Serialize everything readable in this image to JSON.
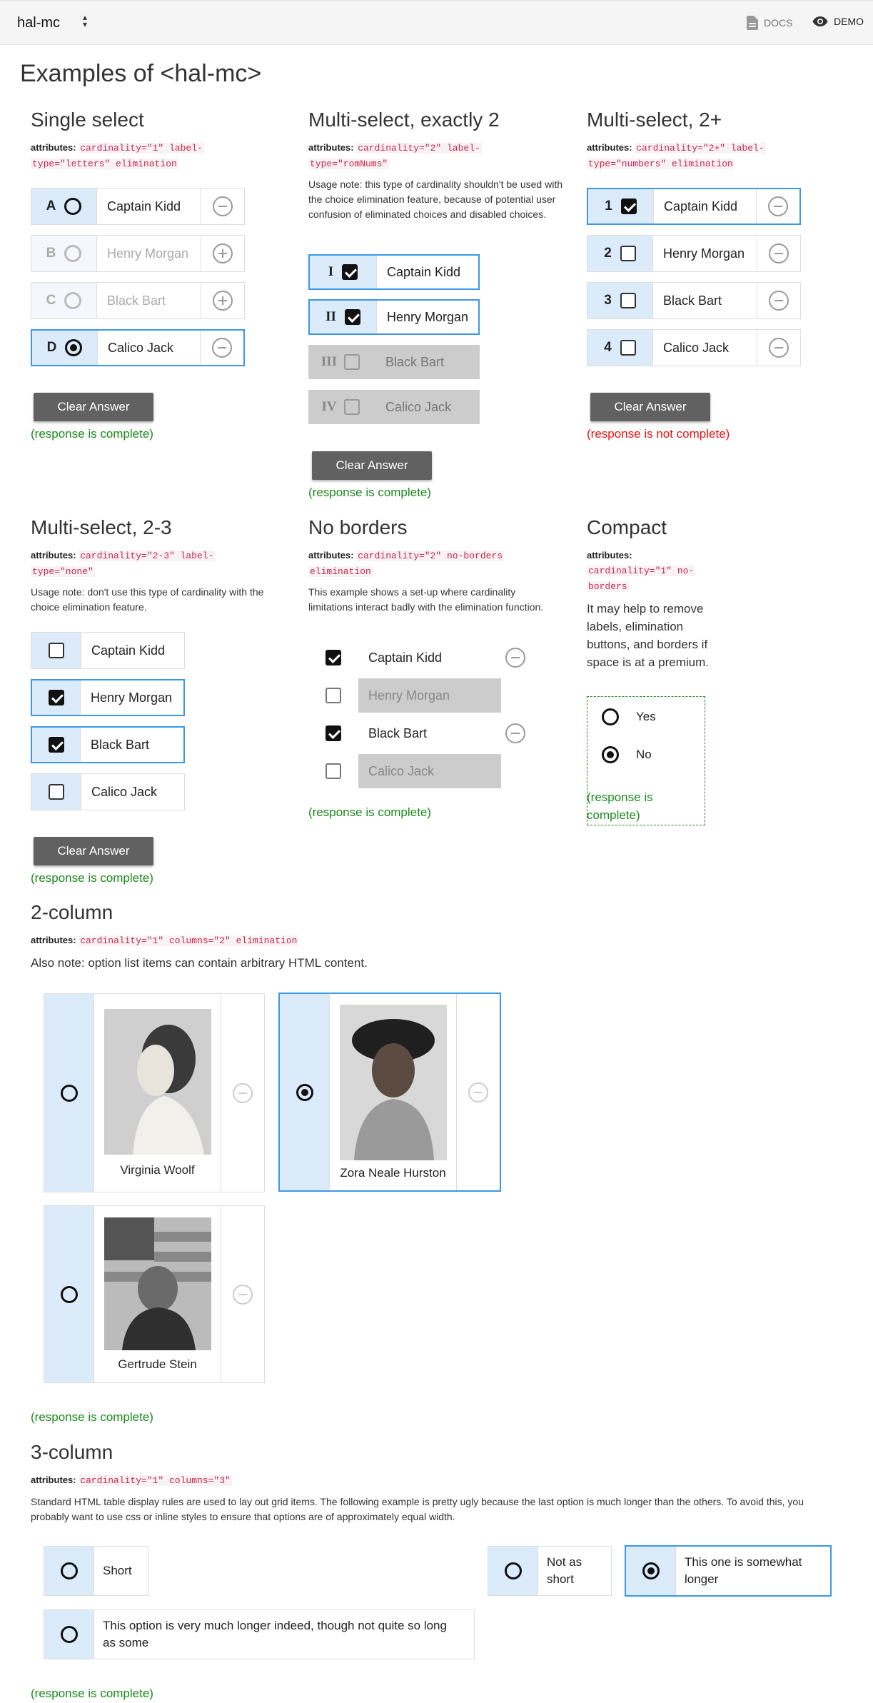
{
  "topbar": {
    "app_select": "hal-mc",
    "select_arrows": "▴\n▾",
    "docs_label": "DOCS",
    "demo_label": "DEMO"
  },
  "page_title": "Examples of <hal-mc>",
  "single": {
    "title": "Single select",
    "attrs_label": "attributes:",
    "attrs_line1": "cardinality=\"1\" label-",
    "attrs_line2": "type=\"letters\" elimination",
    "options": [
      {
        "letter": "A",
        "text": "Captain Kidd"
      },
      {
        "letter": "B",
        "text": "Henry Morgan"
      },
      {
        "letter": "C",
        "text": "Black Bart"
      },
      {
        "letter": "D",
        "text": "Calico Jack"
      }
    ],
    "clear_label": "Clear Answer",
    "status": "(response is complete)"
  },
  "multi2": {
    "title": "Multi-select, exactly 2",
    "attrs_label": "attributes:",
    "attrs_line1": "cardinality=\"2\" label-",
    "attrs_line2": "type=\"romNums\"",
    "note": "Usage note: this type of cardinality shouldn't be used with the choice elimination feature, because of potential user confusion of eliminated choices and disabled choices.",
    "options": [
      {
        "letter": "I",
        "text": "Captain Kidd"
      },
      {
        "letter": "II",
        "text": "Henry Morgan"
      },
      {
        "letter": "III",
        "text": "Black Bart"
      },
      {
        "letter": "IV",
        "text": "Calico Jack"
      }
    ],
    "clear_label": "Clear Answer",
    "status": "(response is complete)"
  },
  "multi2plus": {
    "title": "Multi-select, 2+",
    "attrs_label": "attributes:",
    "attrs_line1": "cardinality=\"2+\" label-",
    "attrs_line2": "type=\"numbers\" elimination",
    "options": [
      {
        "letter": "1",
        "text": "Captain Kidd"
      },
      {
        "letter": "2",
        "text": "Henry Morgan"
      },
      {
        "letter": "3",
        "text": "Black Bart"
      },
      {
        "letter": "4",
        "text": "Calico Jack"
      }
    ],
    "clear_label": "Clear Answer",
    "status": "(response is not complete)"
  },
  "multi23": {
    "title": "Multi-select, 2-3",
    "attrs_label": "attributes:",
    "attrs_line1": "cardinality=\"2-3\" label-",
    "attrs_line2": "type=\"none\"",
    "note": "Usage note: don't use this type of cardinality with the choice elimination feature.",
    "options": [
      "Captain Kidd",
      "Henry Morgan",
      "Black Bart",
      "Calico Jack"
    ],
    "clear_label": "Clear Answer",
    "status": "(response is complete)"
  },
  "noborders": {
    "title": "No borders",
    "attrs_label": "attributes:",
    "attrs_line1": "cardinality=\"2\" no-borders",
    "attrs_line2": "elimination",
    "note": "This example shows a set-up where cardinality limitations interact badly with the elimination function.",
    "options": [
      "Captain Kidd",
      "Henry Morgan",
      "Black Bart",
      "Calico Jack"
    ],
    "status": "(response is complete)"
  },
  "compact": {
    "title": "Compact",
    "attrs_label": "attributes:",
    "attrs_line1": "cardinality=\"1\" no-",
    "attrs_line2": "borders",
    "note": "It may help to remove labels, elimination buttons, and borders if space is at a premium.",
    "options": [
      "Yes",
      "No"
    ],
    "status": "(response is complete)"
  },
  "twocol": {
    "title": "2-column",
    "attrs_label": "attributes:",
    "attrs": "cardinality=\"1\" columns=\"2\" elimination",
    "note": "Also note: option list items can contain arbitrary HTML content.",
    "options": [
      "Virginia Woolf",
      "Zora Neale Hurston",
      "Gertrude Stein"
    ],
    "status": "(response is complete)"
  },
  "threecol": {
    "title": "3-column",
    "attrs_label": "attributes:",
    "attrs": "cardinality=\"1\" columns=\"3\"",
    "note": "Standard HTML table display rules are used to lay out grid items. The following example is pretty ugly because the last option is much longer than the others. To avoid this, you probably want to use css or inline styles to ensure that options are of approximately equal width.",
    "options": [
      "Short",
      "Not as short",
      "This one is somewhat longer",
      "This option is very much longer indeed, though not quite so long as some"
    ],
    "status": "(response is complete)"
  },
  "colors": {
    "accent": "#3b98e6",
    "label_bg": "#dcebfa",
    "ok": "#1a8a1a",
    "error": "#e11111",
    "code": "#c7254e"
  },
  "icons": {
    "docs": "document-icon",
    "demo": "eye-icon",
    "elim_remove": "minus-circle-icon",
    "elim_restore": "plus-circle-icon"
  }
}
